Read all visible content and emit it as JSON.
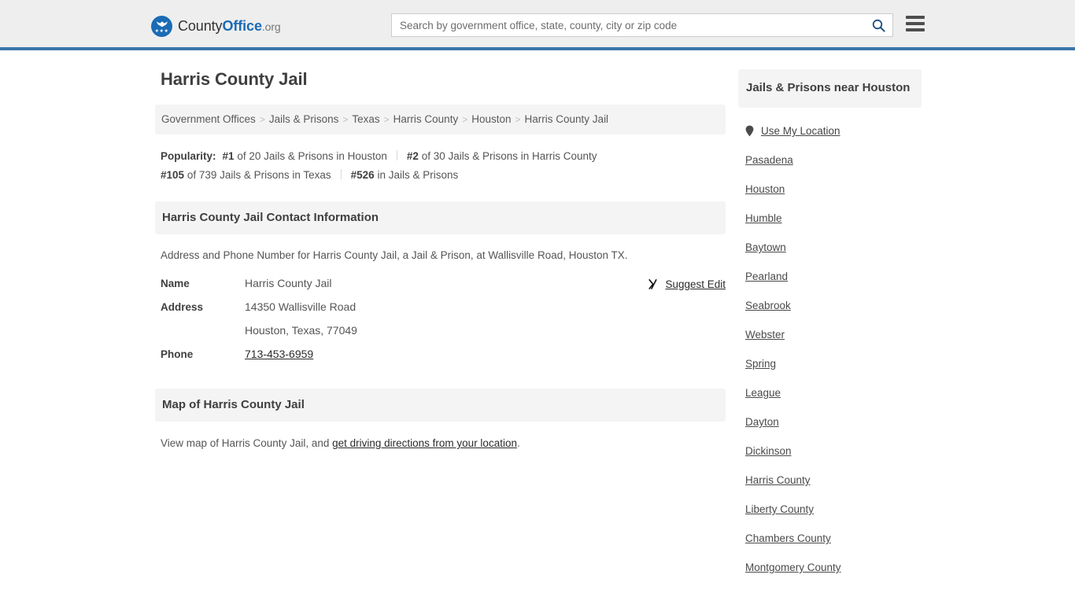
{
  "header": {
    "logo": {
      "part1": "County",
      "part2": "Office",
      "part3": ".org",
      "stars": "★★★"
    },
    "search": {
      "placeholder": "Search by government office, state, county, city or zip code",
      "value": ""
    },
    "menu_label": "Menu"
  },
  "page": {
    "title": "Harris County Jail"
  },
  "breadcrumb": {
    "items": [
      "Government Offices",
      "Jails & Prisons",
      "Texas",
      "Harris County",
      "Houston",
      "Harris County Jail"
    ],
    "separator": ">"
  },
  "popularity": {
    "label": "Popularity:",
    "entries": [
      {
        "rank": "#1",
        "text": "of 20 Jails & Prisons in Houston"
      },
      {
        "rank": "#2",
        "text": "of 30 Jails & Prisons in Harris County"
      },
      {
        "rank": "#105",
        "text": "of 739 Jails & Prisons in Texas"
      },
      {
        "rank": "#526",
        "text": "in Jails & Prisons"
      }
    ]
  },
  "contact": {
    "heading": "Harris County Jail Contact Information",
    "description": "Address and Phone Number for Harris County Jail, a Jail & Prison, at Wallisville Road, Houston TX.",
    "rows": [
      {
        "key": "Name",
        "value": "Harris County Jail"
      },
      {
        "key": "Address",
        "value": "14350 Wallisville Road"
      },
      {
        "key": "",
        "value": "Houston, Texas, 77049"
      },
      {
        "key": "Phone",
        "value": "713-453-6959"
      }
    ],
    "suggest_edit": "Suggest Edit"
  },
  "map": {
    "heading": "Map of Harris County Jail",
    "text_before": "View map of Harris County Jail, and ",
    "link": "get driving directions from your location",
    "text_after": "."
  },
  "sidebar": {
    "heading": "Jails & Prisons near Houston",
    "use_my_location": "Use My Location",
    "items": [
      "Pasadena",
      "Houston",
      "Humble",
      "Baytown",
      "Pearland",
      "Seabrook",
      "Webster",
      "Spring",
      "League",
      "Dayton",
      "Dickinson",
      "Harris County",
      "Liberty County",
      "Chambers County",
      "Montgomery County"
    ]
  },
  "colors": {
    "accent_blue": "#3b75aa",
    "logo_blue": "#1a6bb5",
    "panel_gray": "#f4f4f4",
    "header_gray": "#eeeeee"
  }
}
